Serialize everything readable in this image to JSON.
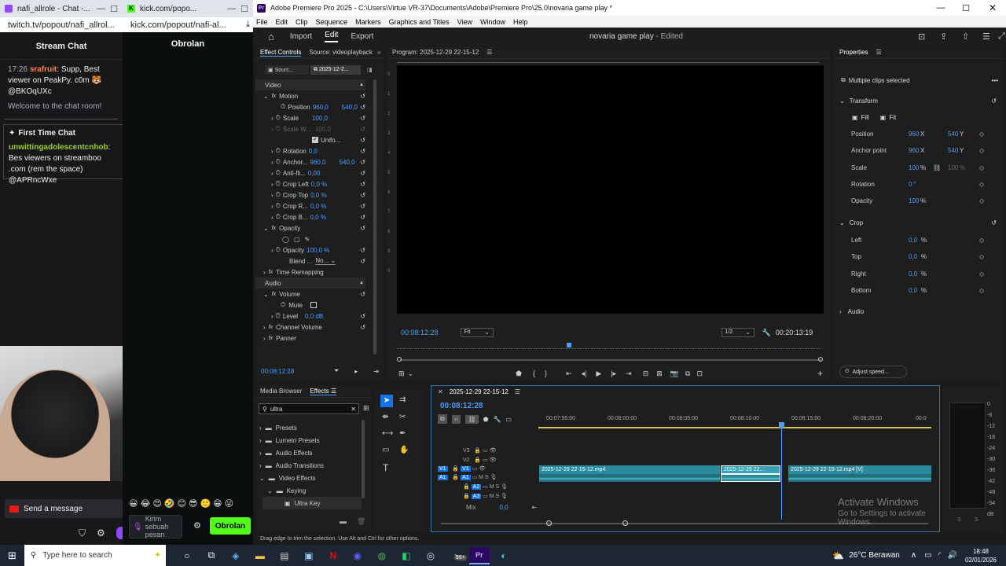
{
  "browser": {
    "tab1": {
      "title": "nafi_allrole - Chat -...",
      "url": "twitch.tv/popout/nafi_allrol..."
    },
    "tab2": {
      "title": "kick.com/popo...",
      "url": "kick.com/popout/nafi-al..."
    }
  },
  "twitch": {
    "title": "Stream Chat",
    "messages": [
      {
        "time": "17:26",
        "user": "srafruit",
        "text": ": Supp, Best viewer on PeakPy. c0m",
        "mention": "@BKOqUXc"
      }
    ],
    "welcome": "Welcome to the chat room!",
    "first_time_label": "First Time Chat",
    "first_msg_user": "unwittingadolescentcnhob",
    "first_msg_text": ": Bes viewers on streamboo .com (rem the space) @APRncWxe",
    "send_placeholder": "Send a message",
    "emotes": [
      "😀",
      "😂",
      "😍",
      "🤣",
      "😊",
      "😎",
      "🙂",
      "😁",
      "😜"
    ]
  },
  "kick": {
    "title": "Obrolan",
    "input_placeholder": "Kirim sebuah pesan",
    "send_button": "Obrolan"
  },
  "premiere": {
    "window_title": "Adobe Premiere Pro 2025 - C:\\Users\\Virtue VR-37\\Documents\\Adobe\\Premiere Pro\\25.0\\novaria game play *",
    "menu": [
      "File",
      "Edit",
      "Clip",
      "Sequence",
      "Markers",
      "Graphics and Titles",
      "View",
      "Window",
      "Help"
    ],
    "workspace_tabs": [
      "Import",
      "Edit",
      "Export"
    ],
    "project_title": "novaria game play",
    "project_status": "- Edited",
    "effect_controls": {
      "tab": "Effect Controls",
      "source_tab": "Source: videoplayback",
      "source_clip": "Sourc...",
      "seq_clip": "2025-12-2...",
      "video_label": "Video",
      "motion": "Motion",
      "position_label": "Position",
      "pos_x": "960,0",
      "pos_y": "540,0",
      "scale_label": "Scale",
      "scale_val": "100,0",
      "scale_w_label": "Scale W...",
      "scale_w_val": "100,0",
      "uniform_label": "Unifo...",
      "rotation_label": "Rotation",
      "rotation_val": "0,0",
      "anchor_label": "Anchor...",
      "anchor_x": "960,0",
      "anchor_y": "540,0",
      "antiflicker_label": "Anti-fli...",
      "antiflicker_val": "0,00",
      "crop_left_label": "Crop Left",
      "crop_left_val": "0,0 %",
      "crop_top_label": "Crop Top",
      "crop_top_val": "0,0 %",
      "crop_right_label": "Crop R...",
      "crop_right_val": "0,0 %",
      "crop_bottom_label": "Crop B...",
      "crop_bottom_val": "0,0 %",
      "opacity": "Opacity",
      "opacity_label": "Opacity",
      "opacity_val": "100,0 %",
      "blend_label": "Blend ...",
      "blend_val": "No...",
      "time_remap": "Time Remapping",
      "audio_label": "Audio",
      "volume": "Volume",
      "mute_label": "Mute",
      "level_label": "Level",
      "level_val": "0,0 dB",
      "channel_volume": "Channel Volume",
      "panner": "Panner",
      "timecode": "00:08:12:28"
    },
    "program": {
      "tab": "Program: 2025-12-29 22-15-12",
      "timecode": "00:08:12:28",
      "fit": "Fit",
      "resolution": "1/2",
      "duration": "00:20:13:19"
    },
    "properties": {
      "tab": "Properties",
      "selection": "Multiple clips selected",
      "transform": "Transform",
      "fill": "Fill",
      "fit": "Fit",
      "position_label": "Position",
      "pos_x": "960",
      "pos_y": "540",
      "anchor_label": "Anchor point",
      "anchor_x": "960",
      "anchor_y": "540",
      "scale_label": "Scale",
      "scale_val": "100",
      "scale_unit": "%",
      "scale_val2": "100",
      "rotation_label": "Rotation",
      "rotation_val": "0",
      "rotation_unit": "°",
      "opacity_label": "Opacity",
      "opacity_val": "100",
      "opacity_unit": "%",
      "crop": "Crop",
      "left_label": "Left",
      "left_val": "0,0",
      "top_label": "Top",
      "top_val": "0,0",
      "right_label": "Right",
      "right_val": "0,0",
      "bottom_label": "Bottom",
      "bottom_val": "0,0",
      "pct": "%",
      "x_unit": "X",
      "y_unit": "Y",
      "audio": "Audio",
      "adjust_speed": "Adjust speed..."
    },
    "media": {
      "tab_browser": "Media Browser",
      "tab_effects": "Effects",
      "search_value": "ultra",
      "items": [
        {
          "label": "Presets"
        },
        {
          "label": "Lumetri Presets"
        },
        {
          "label": "Audio Effects"
        },
        {
          "label": "Audio Transitions"
        },
        {
          "label": "Video Effects"
        },
        {
          "label": "Keying"
        },
        {
          "label": "Ultra Key"
        }
      ]
    },
    "timeline": {
      "tab": "2025-12-29 22-15-12",
      "timecode": "00:08:12:28",
      "ruler": [
        "00:07:55:00",
        "00:08:00:00",
        "00:08:05:00",
        "00:08:10:00",
        "00:08:15:00",
        "00:08:20:00",
        "00:0"
      ],
      "tracks": [
        "V3",
        "V2",
        "V1",
        "A1",
        "A2",
        "A3"
      ],
      "mix_label": "Mix",
      "mix_val": "0,0",
      "clip1": "2025-12-29 22-15-12.mp4",
      "clip2": "2025-12-29 22...",
      "clip3": "2025-12-29 22-15-12.mp4 [V]",
      "meter_labels": [
        "0",
        "-6",
        "-12",
        "-18",
        "-24",
        "-30",
        "-36",
        "-42",
        "-48",
        "-54",
        "dB"
      ],
      "meter_bottom": [
        "S",
        "S"
      ]
    },
    "status": "Drag edge to trim the selection. Use Alt and Ctrl for other options.",
    "activate_title": "Activate Windows",
    "activate_sub": "Go to Settings to activate Windows."
  },
  "taskbar": {
    "search": "Type here to search",
    "weather": "26°C  Berawan",
    "time": "18:48",
    "date": "02/01/2026",
    "badge": "99+"
  }
}
